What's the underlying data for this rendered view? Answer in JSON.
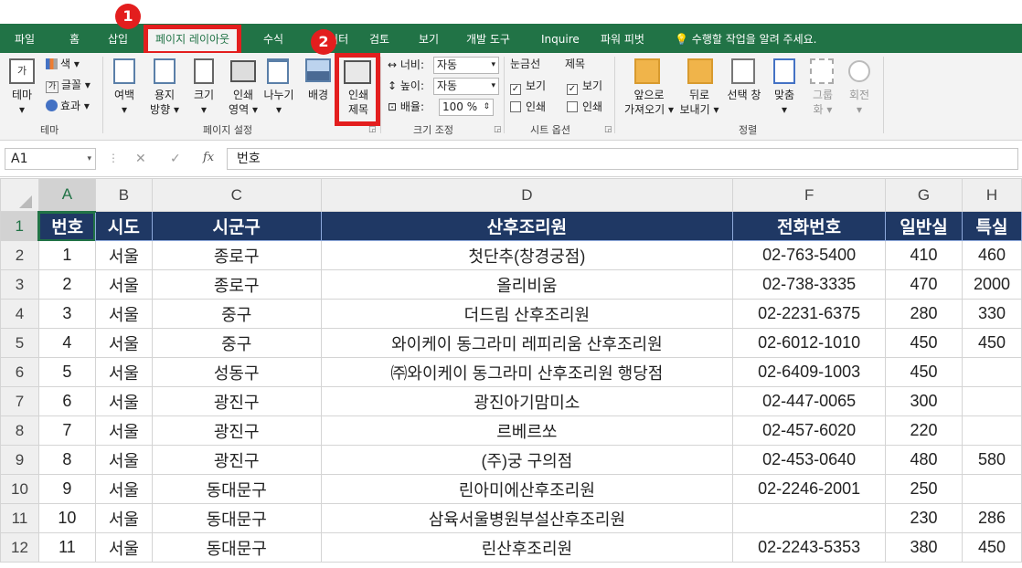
{
  "tabs": [
    "파일",
    "홈",
    "삽입",
    "페이지 레이아웃",
    "수식",
    "데이터",
    "검토",
    "보기",
    "개발 도구",
    "Inquire",
    "파워 피벗"
  ],
  "tell_me": "수행할 작업을 알려 주세요.",
  "badges": [
    "1",
    "2"
  ],
  "ribbon": {
    "theme": {
      "button": "테마",
      "color": "색",
      "font": "글꼴",
      "effects": "효과",
      "group": "테마"
    },
    "page_setup": {
      "margins": "여백",
      "orientation_1": "용지",
      "orientation_2": "방향",
      "size": "크기",
      "print_area_1": "인쇄",
      "print_area_2": "영역",
      "breaks": "나누기",
      "background": "배경",
      "print_titles_1": "인쇄",
      "print_titles_2": "제목",
      "group": "페이지 설정"
    },
    "scale": {
      "width_label": "너비:",
      "width_value": "자동",
      "height_label": "높이:",
      "height_value": "자동",
      "scale_label": "배율:",
      "scale_value": "100 %",
      "group": "크기 조정"
    },
    "sheet_options": {
      "gridlines": "눈금선",
      "headings": "제목",
      "view": "보기",
      "print": "인쇄",
      "group": "시트 옵션"
    },
    "arrange": {
      "bring_1": "앞으로",
      "bring_2": "가져오기",
      "send_1": "뒤로",
      "send_2": "보내기",
      "pane": "선택 창",
      "align": "맞춤",
      "group_1": "그룹",
      "group_2": "화",
      "rotate": "회전",
      "group": "정렬"
    }
  },
  "formula_bar": {
    "name_box": "A1",
    "fx": "fx",
    "content": "번호"
  },
  "sheet": {
    "columns": [
      "A",
      "B",
      "C",
      "D",
      "F",
      "G",
      "H"
    ],
    "rows": [
      {
        "n": "1",
        "cells": [
          "번호",
          "시도",
          "시군구",
          "산후조리원",
          "전화번호",
          "일반실",
          "특실"
        ]
      },
      {
        "n": "2",
        "cells": [
          "1",
          "서울",
          "종로구",
          "첫단추(창경궁점)",
          "02-763-5400",
          "410",
          "460"
        ]
      },
      {
        "n": "3",
        "cells": [
          "2",
          "서울",
          "종로구",
          "올리비움",
          "02-738-3335",
          "470",
          "2000"
        ]
      },
      {
        "n": "4",
        "cells": [
          "3",
          "서울",
          "중구",
          "더드림 산후조리원",
          "02-2231-6375",
          "280",
          "330"
        ]
      },
      {
        "n": "5",
        "cells": [
          "4",
          "서울",
          "중구",
          "와이케이 동그라미 레피리움 산후조리원",
          "02-6012-1010",
          "450",
          "450"
        ]
      },
      {
        "n": "6",
        "cells": [
          "5",
          "서울",
          "성동구",
          "㈜와이케이 동그라미 산후조리원 행당점",
          "02-6409-1003",
          "450",
          ""
        ]
      },
      {
        "n": "7",
        "cells": [
          "6",
          "서울",
          "광진구",
          "광진아기맘미소",
          "02-447-0065",
          "300",
          ""
        ]
      },
      {
        "n": "8",
        "cells": [
          "7",
          "서울",
          "광진구",
          "르베르쏘",
          "02-457-6020",
          "220",
          ""
        ]
      },
      {
        "n": "9",
        "cells": [
          "8",
          "서울",
          "광진구",
          "(주)궁 구의점",
          "02-453-0640",
          "480",
          "580"
        ]
      },
      {
        "n": "10",
        "cells": [
          "9",
          "서울",
          "동대문구",
          "린아미에산후조리원",
          "02-2246-2001",
          "250",
          ""
        ]
      },
      {
        "n": "11",
        "cells": [
          "10",
          "서울",
          "동대문구",
          "삼육서울병원부설산후조리원",
          "",
          "230",
          "286"
        ]
      },
      {
        "n": "12",
        "cells": [
          "11",
          "서울",
          "동대문구",
          "린산후조리원",
          "02-2243-5353",
          "380",
          "450"
        ]
      }
    ]
  },
  "colors": {
    "excel_green": "#217346",
    "header_fill": "#1f3864",
    "highlight_red": "#e31e1e"
  }
}
